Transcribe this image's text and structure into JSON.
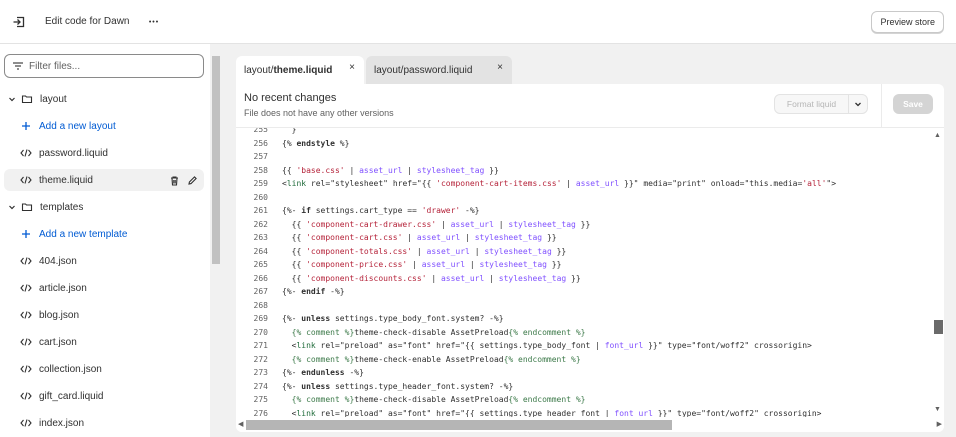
{
  "topbar": {
    "exit_icon": "exit-icon",
    "title": "Edit code for Dawn",
    "more_label": "•••",
    "preview_label": "Preview store"
  },
  "sidebar": {
    "filter_placeholder": "Filter files...",
    "items": [
      {
        "label": "layout",
        "icon": "folder-icon",
        "kind": "folder"
      },
      {
        "label": "Add a new layout",
        "icon": "plus-icon",
        "kind": "add"
      },
      {
        "label": "password.liquid",
        "icon": "code-icon",
        "kind": "file"
      },
      {
        "label": "theme.liquid",
        "icon": "code-icon",
        "kind": "file-selected"
      },
      {
        "label": "templates",
        "icon": "folder-icon",
        "kind": "folder"
      },
      {
        "label": "Add a new template",
        "icon": "plus-icon",
        "kind": "add"
      },
      {
        "label": "404.json",
        "icon": "code-icon",
        "kind": "file"
      },
      {
        "label": "article.json",
        "icon": "code-icon",
        "kind": "file"
      },
      {
        "label": "blog.json",
        "icon": "code-icon",
        "kind": "file"
      },
      {
        "label": "cart.json",
        "icon": "code-icon",
        "kind": "file"
      },
      {
        "label": "collection.json",
        "icon": "code-icon",
        "kind": "file"
      },
      {
        "label": "gift_card.liquid",
        "icon": "code-icon",
        "kind": "file"
      },
      {
        "label": "index.json",
        "icon": "code-icon",
        "kind": "file"
      }
    ]
  },
  "tabs": [
    {
      "dim": "layout/",
      "name": "theme.liquid",
      "active": true,
      "close": "×"
    },
    {
      "dim": "layout/",
      "name": "password.liquid",
      "active": false,
      "close": "×"
    }
  ],
  "editor": {
    "status_title": "No recent changes",
    "status_subtitle": "File does not have any other versions",
    "format_label": "Format liquid",
    "save_label": "Save",
    "lines": [
      {
        "n": "255",
        "t": "  }"
      },
      {
        "n": "256",
        "t": "{% endstyle %}"
      },
      {
        "n": "257",
        "t": ""
      },
      {
        "n": "258",
        "t": "{{ 'base.css' | asset_url | stylesheet_tag }}"
      },
      {
        "n": "259",
        "t": "<link rel=\"stylesheet\" href=\"{{ 'component-cart-items.css' | asset_url }}\" media=\"print\" onload=\"this.media='all'\">"
      },
      {
        "n": "260",
        "t": ""
      },
      {
        "n": "261",
        "t": "{%- if settings.cart_type == 'drawer' -%}"
      },
      {
        "n": "262",
        "t": "  {{ 'component-cart-drawer.css' | asset_url | stylesheet_tag }}"
      },
      {
        "n": "263",
        "t": "  {{ 'component-cart.css' | asset_url | stylesheet_tag }}"
      },
      {
        "n": "264",
        "t": "  {{ 'component-totals.css' | asset_url | stylesheet_tag }}"
      },
      {
        "n": "265",
        "t": "  {{ 'component-price.css' | asset_url | stylesheet_tag }}"
      },
      {
        "n": "266",
        "t": "  {{ 'component-discounts.css' | asset_url | stylesheet_tag }}"
      },
      {
        "n": "267",
        "t": "{%- endif -%}"
      },
      {
        "n": "268",
        "t": ""
      },
      {
        "n": "269",
        "t": "{%- unless settings.type_body_font.system? -%}"
      },
      {
        "n": "270",
        "t": "  {% comment %}theme-check-disable AssetPreload{% endcomment %}"
      },
      {
        "n": "271",
        "t": "  <link rel=\"preload\" as=\"font\" href=\"{{ settings.type_body_font | font_url }}\" type=\"font/woff2\" crossorigin>"
      },
      {
        "n": "272",
        "t": "  {% comment %}theme-check-enable AssetPreload{% endcomment %}"
      },
      {
        "n": "273",
        "t": "{%- endunless -%}"
      },
      {
        "n": "274",
        "t": "{%- unless settings.type_header_font.system? -%}"
      },
      {
        "n": "275",
        "t": "  {% comment %}theme-check-disable AssetPreload{% endcomment %}"
      },
      {
        "n": "276",
        "t": "  <link rel=\"preload\" as=\"font\" href=\"{{ settings.type_header_font | font_url }}\" type=\"font/woff2\" crossorigin>"
      }
    ]
  },
  "colors": {
    "accent_link": "#005bd3",
    "code_string": "#b5233a",
    "code_filter": "#8051ff",
    "code_tag": "#1f6b3a"
  }
}
